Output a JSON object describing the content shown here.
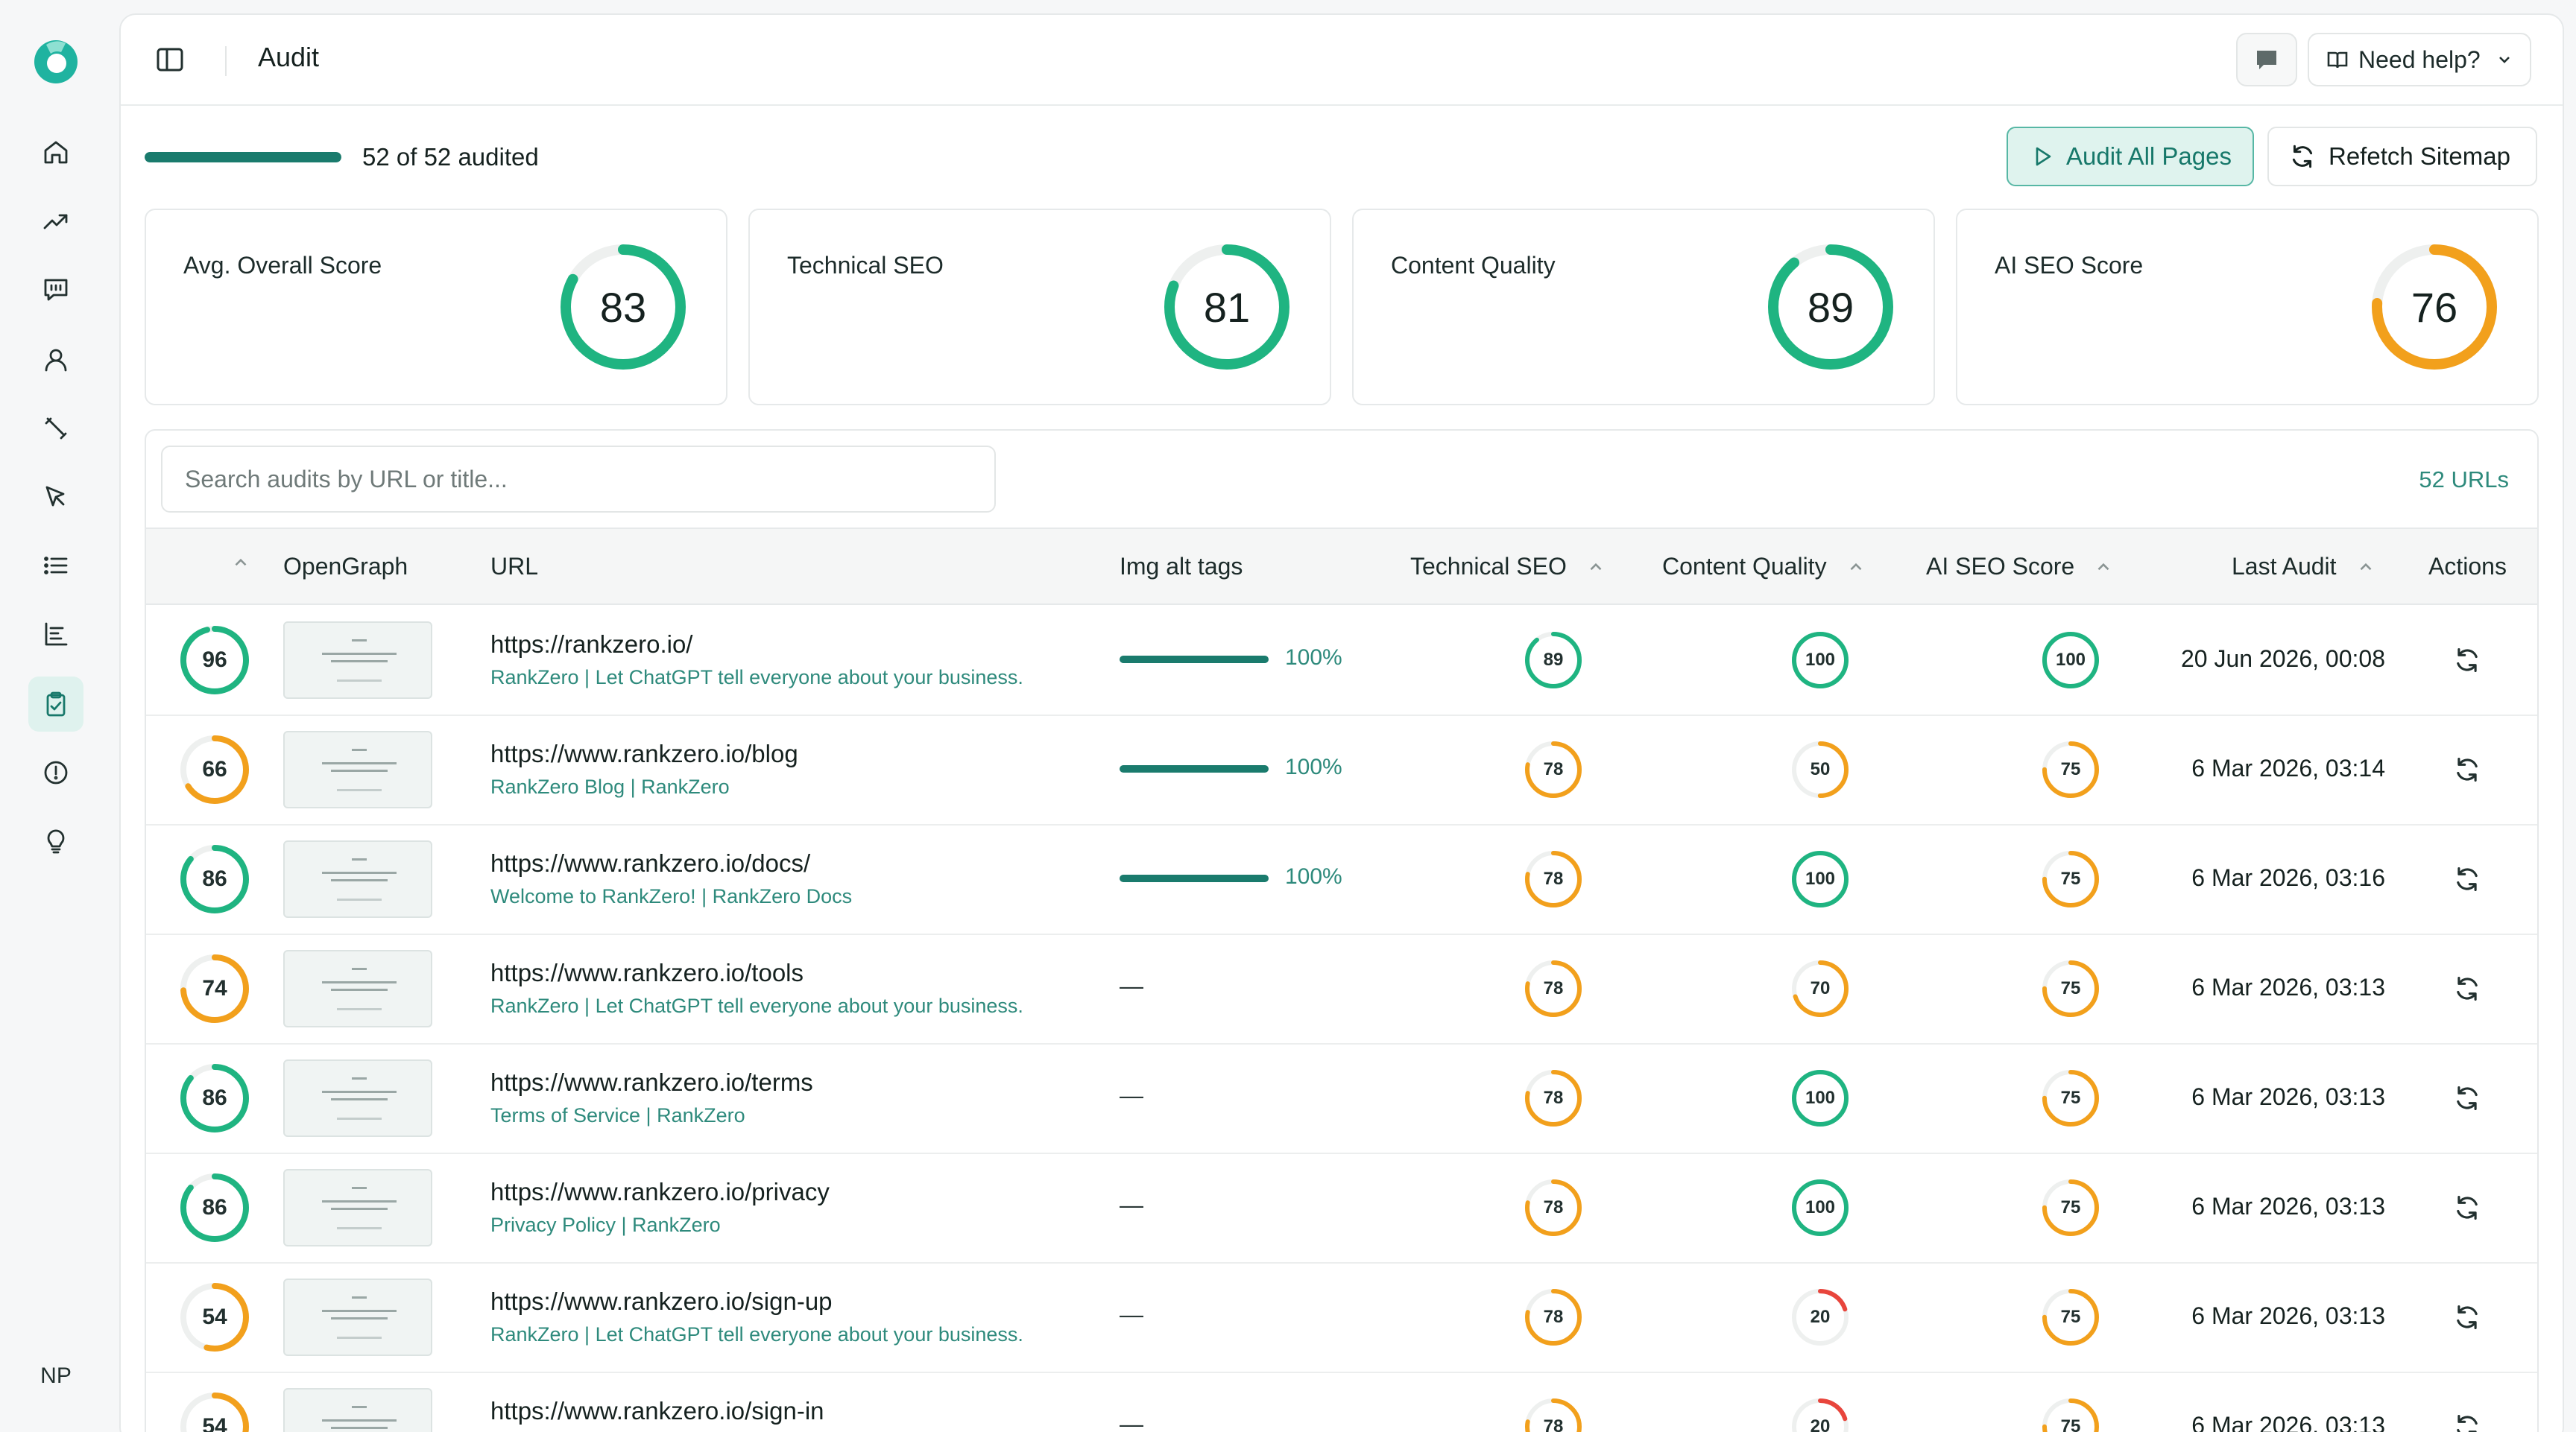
{
  "rail": {
    "avatar_initials": "NP",
    "items": [
      {
        "icon": "home-icon",
        "active": false
      },
      {
        "icon": "trending-icon",
        "active": false
      },
      {
        "icon": "message-icon",
        "active": false
      },
      {
        "icon": "user-icon",
        "active": false
      },
      {
        "icon": "pen-icon",
        "active": false
      },
      {
        "icon": "cursor-icon",
        "active": false
      },
      {
        "icon": "list-icon",
        "active": false
      },
      {
        "icon": "bar-list-icon",
        "active": false
      },
      {
        "icon": "clipboard-check-icon",
        "active": true
      },
      {
        "icon": "alert-circle-icon",
        "active": false
      },
      {
        "icon": "lightbulb-icon",
        "active": false
      }
    ]
  },
  "header": {
    "title": "Audit",
    "help_label": "Need help?"
  },
  "progress": {
    "audited": 52,
    "total": 52,
    "label": "52 of 52 audited"
  },
  "toolbar": {
    "audit_all_label": "Audit All Pages",
    "refetch_label": "Refetch Sitemap"
  },
  "stats": [
    {
      "title": "Avg. Overall Score",
      "value": "83",
      "score": 83
    },
    {
      "title": "Technical SEO",
      "value": "81",
      "score": 81
    },
    {
      "title": "Content Quality",
      "value": "89",
      "score": 89
    },
    {
      "title": "AI SEO Score",
      "value": "76",
      "score": 76
    }
  ],
  "table": {
    "search_placeholder": "Search audits by URL or title...",
    "url_count": "52 URLs",
    "columns": {
      "opengraph": "OpenGraph",
      "url": "URL",
      "img_alt": "Img alt tags",
      "technical": "Technical SEO",
      "content": "Content Quality",
      "ai": "AI SEO Score",
      "last_audit": "Last Audit",
      "actions": "Actions"
    },
    "rows": [
      {
        "overall": "96",
        "url": "https://rankzero.io/",
        "title": "RankZero | Let ChatGPT tell everyone about your business.",
        "alt": "100%",
        "technical": "89",
        "content": "100",
        "ai": "100",
        "last_audit": "20 Jun 2026, 00:08"
      },
      {
        "overall": "66",
        "url": "https://www.rankzero.io/blog",
        "title": "RankZero Blog | RankZero",
        "alt": "100%",
        "technical": "78",
        "content": "50",
        "ai": "75",
        "last_audit": "6 Mar 2026, 03:14"
      },
      {
        "overall": "86",
        "url": "https://www.rankzero.io/docs/",
        "title": "Welcome to RankZero! | RankZero Docs",
        "alt": "100%",
        "technical": "78",
        "content": "100",
        "ai": "75",
        "last_audit": "6 Mar 2026, 03:16"
      },
      {
        "overall": "74",
        "url": "https://www.rankzero.io/tools",
        "title": "RankZero | Let ChatGPT tell everyone about your business.",
        "alt": "—",
        "technical": "78",
        "content": "70",
        "ai": "75",
        "last_audit": "6 Mar 2026, 03:13"
      },
      {
        "overall": "86",
        "url": "https://www.rankzero.io/terms",
        "title": "Terms of Service | RankZero",
        "alt": "—",
        "technical": "78",
        "content": "100",
        "ai": "75",
        "last_audit": "6 Mar 2026, 03:13"
      },
      {
        "overall": "86",
        "url": "https://www.rankzero.io/privacy",
        "title": "Privacy Policy | RankZero",
        "alt": "—",
        "technical": "78",
        "content": "100",
        "ai": "75",
        "last_audit": "6 Mar 2026, 03:13"
      },
      {
        "overall": "54",
        "url": "https://www.rankzero.io/sign-up",
        "title": "RankZero | Let ChatGPT tell everyone about your business.",
        "alt": "—",
        "technical": "78",
        "content": "20",
        "ai": "75",
        "last_audit": "6 Mar 2026, 03:13"
      },
      {
        "overall": "54",
        "url": "https://www.rankzero.io/sign-in",
        "title": "",
        "alt": "—",
        "technical": "78",
        "content": "20",
        "ai": "75",
        "last_audit": "6 Mar 2026, 03:13"
      }
    ]
  },
  "colors": {
    "accent": "#1a7b6d",
    "good": "#1fb481",
    "medium": "#f2a01c",
    "poor": "#e8453c",
    "track": "#eef0ef"
  }
}
